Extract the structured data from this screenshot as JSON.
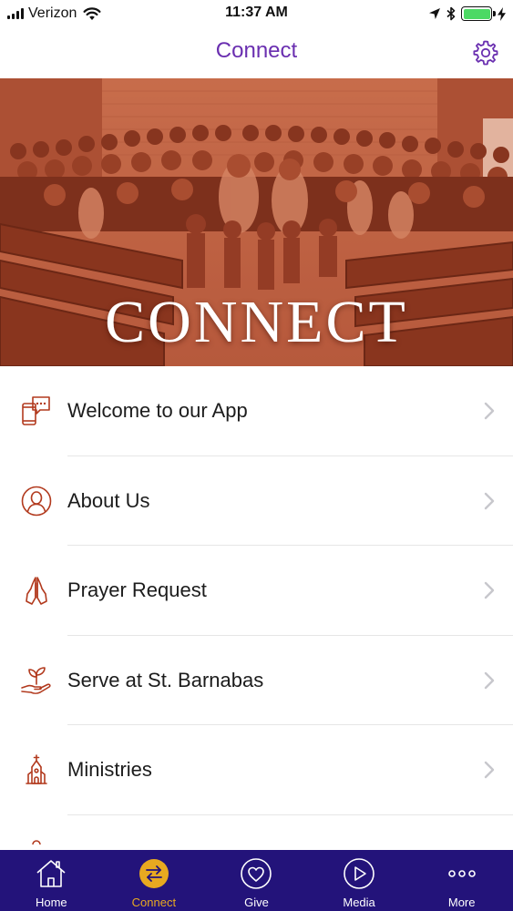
{
  "status_bar": {
    "carrier": "Verizon",
    "time": "11:37 AM"
  },
  "nav": {
    "title": "Connect",
    "settings_icon": "gear-icon"
  },
  "hero": {
    "title": "CONNECT"
  },
  "menu": {
    "items": [
      {
        "label": "Welcome to our App",
        "icon": "chat-phone-icon"
      },
      {
        "label": "About Us",
        "icon": "person-circle-icon"
      },
      {
        "label": "Prayer Request",
        "icon": "praying-hands-icon"
      },
      {
        "label": "Serve at St. Barnabas",
        "icon": "hand-plant-icon"
      },
      {
        "label": "Ministries",
        "icon": "church-icon"
      }
    ]
  },
  "tabs": [
    {
      "label": "Home",
      "icon": "home-icon"
    },
    {
      "label": "Connect",
      "icon": "swap-arrows-icon",
      "active": true
    },
    {
      "label": "Give",
      "icon": "heart-icon"
    },
    {
      "label": "Media",
      "icon": "play-icon"
    },
    {
      "label": "More",
      "icon": "dots-icon"
    }
  ],
  "colors": {
    "accent": "#6a2fb0",
    "icon": "#b23a1e",
    "tab_bar": "#23137a",
    "tab_active": "#e8a920",
    "hero_tint": "#b4583c"
  }
}
